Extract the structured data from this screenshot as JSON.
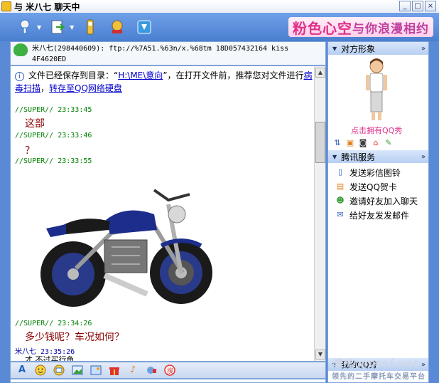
{
  "window": {
    "title": "与 米八七 聊天中",
    "buttons": [
      "_",
      "□",
      "×"
    ]
  },
  "toolbar": {
    "icons": [
      "microphone-icon",
      "file-transfer-icon",
      "phone-icon",
      "game-icon",
      "app-icon"
    ],
    "banner_part1": "粉色心空",
    "banner_part2": "与你浪漫相约"
  },
  "contact": {
    "name": "米八七",
    "qq": "(298440609)",
    "status_text": "ftp://%7A51.%63n/x.%68tm 18D057432164  kiss",
    "status_line2": "4F4620ED"
  },
  "chat": {
    "notice_prefix": "文件已经保存到目录：“",
    "notice_path": "H:\\ME\\意向",
    "notice_mid": "”，在打开文件前，推荐您对文件进行",
    "notice_link1": "病毒扫描",
    "notice_sep": "，",
    "notice_link2": "转存至QQ网络硬盘",
    "messages": [
      {
        "sender": "//SUPER//",
        "time": "23:33:45",
        "text": "这部"
      },
      {
        "sender": "//SUPER//",
        "time": "23:33:46",
        "text": "？"
      },
      {
        "sender": "//SUPER//",
        "time": "23:33:55",
        "text": ""
      },
      {
        "sender": "//SUPER//",
        "time": "23:34:26",
        "text": "多少钱呢？车况如何？"
      },
      {
        "sender": "米八七",
        "time": "23:35:26",
        "text": "才 不过买行鱼"
      }
    ]
  },
  "input_toolbar": {
    "icons": [
      "font-icon",
      "emoji-icon",
      "screenshot-icon",
      "image-icon",
      "scene-icon",
      "gift-icon",
      "music-icon",
      "video-icon",
      "search-icon"
    ]
  },
  "right_panel": {
    "section1_title": "对方形象",
    "avatar_label": "点击拥有QQ秀",
    "section2_title": "腾讯服务",
    "services": [
      {
        "icon": "phone-icon",
        "label": "发送彩信图铃"
      },
      {
        "icon": "card-icon",
        "label": "发送QQ贺卡"
      },
      {
        "icon": "friends-icon",
        "label": "邀请好友加入聊天"
      },
      {
        "icon": "mail-icon",
        "label": "给好友发发邮件"
      }
    ],
    "section3_title": "我的QQ秀"
  },
  "watermark": {
    "main": "摩托/motof.net",
    "sub": "领先的二手摩托车交易平台"
  }
}
